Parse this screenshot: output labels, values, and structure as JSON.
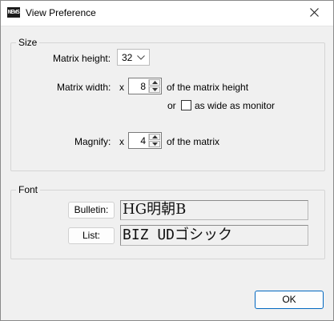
{
  "window": {
    "title": "View Preference",
    "icon": "news-app-icon",
    "icon_text": "NEWS"
  },
  "size_group": {
    "legend": "Size",
    "matrix_height": {
      "label": "Matrix height:",
      "value": "32"
    },
    "matrix_width": {
      "label": "Matrix width:",
      "x": "x",
      "value": "8",
      "suffix": "of the matrix height",
      "or": "or",
      "checkbox_label": "as wide as monitor",
      "checked": false
    },
    "magnify": {
      "label": "Magnify:",
      "x": "x",
      "value": "4",
      "suffix": "of the matrix"
    }
  },
  "font_group": {
    "legend": "Font",
    "bulletin": {
      "button": "Bulletin:",
      "value": "HG明朝B"
    },
    "list": {
      "button": "List:",
      "value": "BIZ UDゴシック"
    }
  },
  "ok_label": "OK",
  "colors": {
    "accent": "#0067c0",
    "background": "#f0f0f0"
  }
}
